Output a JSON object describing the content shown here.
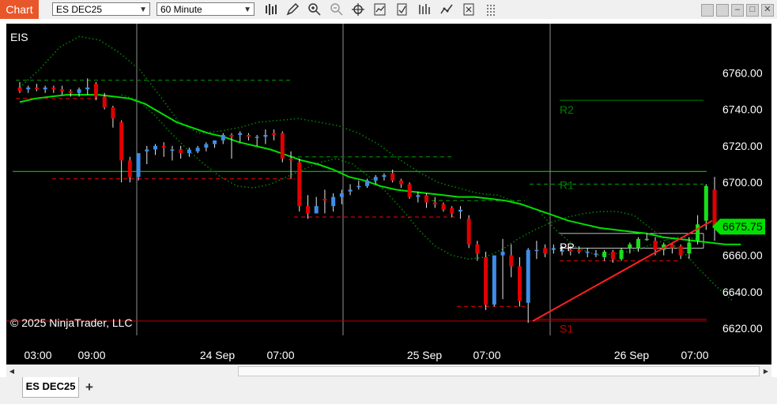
{
  "toolbar": {
    "chart_label": "Chart",
    "instrument": "ES DEC25",
    "interval": "60 Minute",
    "tools": [
      "bar-type-icon",
      "draw-pencil-icon",
      "zoom-in-icon",
      "zoom-out-icon",
      "crosshair-icon",
      "indicators-icon",
      "strategies-icon",
      "data-box-icon",
      "drawing-tools-icon",
      "snapshot-icon",
      "properties-icon"
    ]
  },
  "chart": {
    "symbol": "EIS",
    "copyright": "© 2025 NinjaTrader, LLC",
    "price_labels": [
      "6760.00",
      "6740.00",
      "6720.00",
      "6700.00",
      "6660.00",
      "6640.00",
      "6620.00"
    ],
    "current_price": "6675.75",
    "pivot_labels": {
      "r2": "R2",
      "r1": "R1",
      "pp": "PP",
      "s1": "S1"
    },
    "time_labels": [
      "03:00",
      "09:00",
      "24 Sep",
      "07:00",
      "25 Sep",
      "07:00",
      "26 Sep",
      "07:00"
    ],
    "colors": {
      "up": "#3d8ee8",
      "down": "#e00000",
      "green_up": "#18e018",
      "ma": "#00e000",
      "band": "#008000",
      "pivot": "#008000",
      "support": "#c00000",
      "trend": "#ff2020",
      "price_tag": "#00e000"
    }
  },
  "chart_data": {
    "type": "candlestick",
    "ylim": [
      6614,
      6774
    ],
    "bars": [
      {
        "o": 6752,
        "h": 6755,
        "l": 6749,
        "c": 6750
      },
      {
        "o": 6751,
        "h": 6753,
        "l": 6749,
        "c": 6752
      },
      {
        "o": 6752,
        "h": 6754,
        "l": 6750,
        "c": 6751
      },
      {
        "o": 6751,
        "h": 6753,
        "l": 6749,
        "c": 6752
      },
      {
        "o": 6752,
        "h": 6753,
        "l": 6749,
        "c": 6751
      },
      {
        "o": 6751,
        "h": 6753,
        "l": 6748,
        "c": 6750
      },
      {
        "o": 6750,
        "h": 6751,
        "l": 6747,
        "c": 6749
      },
      {
        "o": 6749,
        "h": 6752,
        "l": 6747,
        "c": 6751
      },
      {
        "o": 6751,
        "h": 6757,
        "l": 6748,
        "c": 6752
      },
      {
        "o": 6754,
        "h": 6755,
        "l": 6745,
        "c": 6747
      },
      {
        "o": 6747,
        "h": 6749,
        "l": 6740,
        "c": 6741
      },
      {
        "o": 6741,
        "h": 6742,
        "l": 6730,
        "c": 6735
      },
      {
        "o": 6733,
        "h": 6734,
        "l": 6700,
        "c": 6712
      },
      {
        "o": 6712,
        "h": 6714,
        "l": 6700,
        "c": 6703
      },
      {
        "o": 6703,
        "h": 6716,
        "l": 6701,
        "c": 6716
      },
      {
        "o": 6717,
        "h": 6720,
        "l": 6710,
        "c": 6718
      },
      {
        "o": 6718,
        "h": 6721,
        "l": 6715,
        "c": 6720
      },
      {
        "o": 6720,
        "h": 6722,
        "l": 6714,
        "c": 6719
      },
      {
        "o": 6718,
        "h": 6720,
        "l": 6712,
        "c": 6718
      },
      {
        "o": 6718,
        "h": 6720,
        "l": 6713,
        "c": 6716
      },
      {
        "o": 6716,
        "h": 6719,
        "l": 6714,
        "c": 6718
      },
      {
        "o": 6717,
        "h": 6720,
        "l": 6716,
        "c": 6719
      },
      {
        "o": 6719,
        "h": 6722,
        "l": 6717,
        "c": 6721
      },
      {
        "o": 6721,
        "h": 6723,
        "l": 6719,
        "c": 6723
      },
      {
        "o": 6723,
        "h": 6727,
        "l": 6721,
        "c": 6726
      },
      {
        "o": 6726,
        "h": 6727,
        "l": 6713,
        "c": 6725
      },
      {
        "o": 6726,
        "h": 6728,
        "l": 6722,
        "c": 6727
      },
      {
        "o": 6726,
        "h": 6727,
        "l": 6723,
        "c": 6725
      },
      {
        "o": 6725,
        "h": 6726,
        "l": 6720,
        "c": 6725
      },
      {
        "o": 6725,
        "h": 6729,
        "l": 6721,
        "c": 6726
      },
      {
        "o": 6727,
        "h": 6729,
        "l": 6723,
        "c": 6726
      },
      {
        "o": 6727,
        "h": 6728,
        "l": 6711,
        "c": 6713
      },
      {
        "o": 6713,
        "h": 6717,
        "l": 6702,
        "c": 6712
      },
      {
        "o": 6711,
        "h": 6713,
        "l": 6684,
        "c": 6687
      },
      {
        "o": 6687,
        "h": 6693,
        "l": 6680,
        "c": 6683
      },
      {
        "o": 6683,
        "h": 6692,
        "l": 6683,
        "c": 6687
      },
      {
        "o": 6691,
        "h": 6696,
        "l": 6683,
        "c": 6690
      },
      {
        "o": 6687,
        "h": 6694,
        "l": 6684,
        "c": 6692
      },
      {
        "o": 6692,
        "h": 6696,
        "l": 6688,
        "c": 6694
      },
      {
        "o": 6695,
        "h": 6699,
        "l": 6693,
        "c": 6696
      },
      {
        "o": 6698,
        "h": 6701,
        "l": 6696,
        "c": 6698
      },
      {
        "o": 6698,
        "h": 6702,
        "l": 6697,
        "c": 6701
      },
      {
        "o": 6701,
        "h": 6704,
        "l": 6699,
        "c": 6703
      },
      {
        "o": 6703,
        "h": 6705,
        "l": 6701,
        "c": 6704
      },
      {
        "o": 6705,
        "h": 6707,
        "l": 6700,
        "c": 6701
      },
      {
        "o": 6701,
        "h": 6702,
        "l": 6697,
        "c": 6699
      },
      {
        "o": 6699,
        "h": 6700,
        "l": 6691,
        "c": 6692
      },
      {
        "o": 6692,
        "h": 6695,
        "l": 6689,
        "c": 6693
      },
      {
        "o": 6693,
        "h": 6694,
        "l": 6686,
        "c": 6689
      },
      {
        "o": 6689,
        "h": 6692,
        "l": 6686,
        "c": 6688
      },
      {
        "o": 6688,
        "h": 6689,
        "l": 6684,
        "c": 6685
      },
      {
        "o": 6686,
        "h": 6687,
        "l": 6681,
        "c": 6683
      },
      {
        "o": 6684,
        "h": 6687,
        "l": 6680,
        "c": 6685
      },
      {
        "o": 6680,
        "h": 6682,
        "l": 6664,
        "c": 6666
      },
      {
        "o": 6666,
        "h": 6668,
        "l": 6657,
        "c": 6661
      },
      {
        "o": 6659,
        "h": 6662,
        "l": 6630,
        "c": 6633
      },
      {
        "o": 6633,
        "h": 6648,
        "l": 6632,
        "c": 6660
      },
      {
        "o": 6660,
        "h": 6669,
        "l": 6636,
        "c": 6662
      },
      {
        "o": 6660,
        "h": 6666,
        "l": 6648,
        "c": 6654
      },
      {
        "o": 6654,
        "h": 6659,
        "l": 6632,
        "c": 6635
      },
      {
        "o": 6634,
        "h": 6664,
        "l": 6623,
        "c": 6663
      },
      {
        "o": 6663,
        "h": 6668,
        "l": 6658,
        "c": 6663
      },
      {
        "o": 6664,
        "h": 6666,
        "l": 6659,
        "c": 6661
      },
      {
        "o": 6663,
        "h": 6666,
        "l": 6661,
        "c": 6664
      },
      {
        "o": 6662,
        "h": 6665,
        "l": 6660,
        "c": 6663
      },
      {
        "o": 6663,
        "h": 6665,
        "l": 6660,
        "c": 6662
      },
      {
        "o": 6663,
        "h": 6665,
        "l": 6661,
        "c": 6662
      },
      {
        "o": 6662,
        "h": 6664,
        "l": 6659,
        "c": 6662
      },
      {
        "o": 6661,
        "h": 6663,
        "l": 6659,
        "c": 6661
      },
      {
        "o": 6659,
        "h": 6663,
        "l": 6657,
        "c": 6662
      },
      {
        "o": 6662,
        "h": 6663,
        "l": 6656,
        "c": 6658
      },
      {
        "o": 6658,
        "h": 6664,
        "l": 6657,
        "c": 6663
      },
      {
        "o": 6664,
        "h": 6667,
        "l": 6661,
        "c": 6666
      },
      {
        "o": 6664,
        "h": 6670,
        "l": 6662,
        "c": 6669
      },
      {
        "o": 6669,
        "h": 6672,
        "l": 6668,
        "c": 6669
      },
      {
        "o": 6668,
        "h": 6670,
        "l": 6660,
        "c": 6663
      },
      {
        "o": 6663,
        "h": 6667,
        "l": 6660,
        "c": 6666
      },
      {
        "o": 6666,
        "h": 6667,
        "l": 6661,
        "c": 6664
      },
      {
        "o": 6665,
        "h": 6666,
        "l": 6658,
        "c": 6660
      },
      {
        "o": 6661,
        "h": 6670,
        "l": 6658,
        "c": 6667
      },
      {
        "o": 6668,
        "h": 6682,
        "l": 6666,
        "c": 6677
      },
      {
        "o": 6679,
        "h": 6699,
        "l": 6674,
        "c": 6698
      },
      {
        "o": 6696,
        "h": 6703,
        "l": 6668,
        "c": 6675
      }
    ],
    "ma": [
      6744,
      6746,
      6747,
      6748,
      6748,
      6748,
      6747,
      6746,
      6743,
      6738,
      6733,
      6730,
      6727,
      6725,
      6722,
      6720,
      6718,
      6715,
      6712,
      6710,
      6707,
      6703,
      6701,
      6698,
      6696,
      6695,
      6694,
      6693,
      6692,
      6692,
      6691,
      6690,
      6688,
      6685,
      6682,
      6679,
      6677,
      6675,
      6674,
      6673,
      6672,
      6670,
      6669,
      6668,
      6667,
      6666,
      6666
    ],
    "bb_upper": [
      6752,
      6762,
      6774,
      6780,
      6778,
      6771,
      6762,
      6748,
      6733,
      6727,
      6728,
      6730,
      6733,
      6734,
      6735,
      6733,
      6731,
      6727,
      6721,
      6713,
      6706,
      6700,
      6697,
      6694,
      6693,
      6689,
      6685,
      6673,
      6664,
      6660,
      6661,
      6663,
      6667,
      6670,
      6669
    ],
    "bb_lower": [
      6748,
      6745,
      6737,
      6727,
      6718,
      6710,
      6703,
      6698,
      6697,
      6699,
      6703,
      6707,
      6711,
      6713,
      6710,
      6703,
      6695,
      6685,
      6674,
      6665,
      6660,
      6658,
      6659,
      6663,
      6669,
      6674,
      6678,
      6681,
      6683,
      6684,
      6684,
      6682,
      6675,
      6668,
      6662,
      6652,
      6643,
      6635
    ],
    "pivot": {
      "r2": 6745,
      "r1": 6699,
      "pp": 6665,
      "s1": 6625
    },
    "hline": 6706,
    "current": 6675.75
  }
}
